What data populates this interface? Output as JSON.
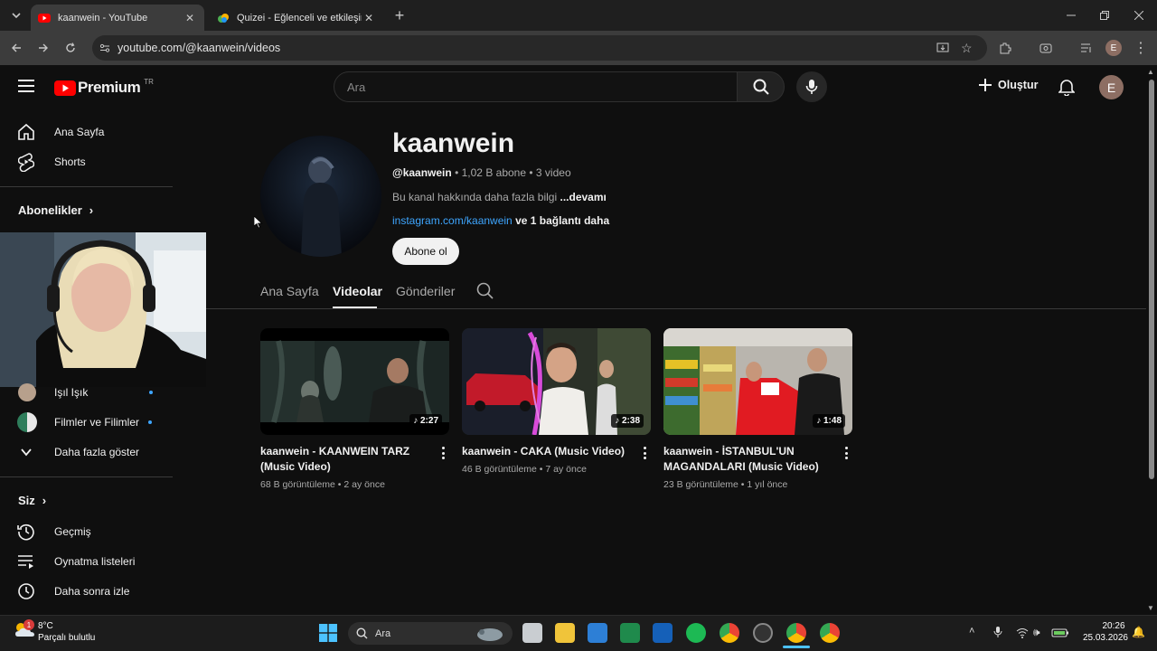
{
  "browser": {
    "tabs": [
      {
        "title": "kaanwein - YouTube",
        "icon": "youtube-favicon"
      },
      {
        "title": "Quizei - Eğlenceli ve etkileşimli",
        "icon": "quizei-favicon"
      }
    ],
    "url": "youtube.com/@kaanwein/videos"
  },
  "youtube": {
    "logo_text": "Premium",
    "logo_region": "TR",
    "search_placeholder": "Ara",
    "create_label": "Oluştur",
    "avatar_letter": "E"
  },
  "sidebar": {
    "top_items": [
      {
        "label": "Ana Sayfa",
        "icon": "home-icon"
      },
      {
        "label": "Shorts",
        "icon": "shorts-icon"
      }
    ],
    "subscriptions_title": "Abonelikler",
    "subscriptions": [
      {
        "label": "Işıl Işık"
      },
      {
        "label": "Filmler ve Filimler"
      }
    ],
    "show_more": "Daha fazla göster",
    "you_title": "Siz",
    "you_items": [
      {
        "label": "Geçmiş",
        "icon": "history-icon"
      },
      {
        "label": "Oynatma listeleri",
        "icon": "playlist-icon"
      },
      {
        "label": "Daha sonra izle",
        "icon": "clock-icon"
      }
    ]
  },
  "channel": {
    "name": "kaanwein",
    "handle": "@kaanwein",
    "subscribers": "1,02 B abone",
    "video_count": "3 video",
    "description": "Bu kanal hakkında daha fazla bilgi",
    "more": "...devamı",
    "link": "instagram.com/kaanwein",
    "link_more": "ve 1 bağlantı daha",
    "subscribe_label": "Abone ol"
  },
  "tabs": [
    "Ana Sayfa",
    "Videolar",
    "Gönderiler"
  ],
  "videos": [
    {
      "title": "kaanwein - KAANWEIN TARZ (Music Video)",
      "duration": "2:27",
      "views": "68 B görüntüleme",
      "age": "2 ay önce"
    },
    {
      "title": "kaanwein - CAKA (Music Video)",
      "duration": "2:38",
      "views": "46 B görüntüleme",
      "age": "7 ay önce"
    },
    {
      "title": "kaanwein - İSTANBUL'UN MAGANDALARI (Music Video)",
      "duration": "1:48",
      "views": "23 B görüntüleme",
      "age": "1 yıl önce"
    }
  ],
  "taskbar": {
    "weather_temp": "8°C",
    "weather_text": "Parçalı bulutlu",
    "weather_badge": "1",
    "search_label": "Ara",
    "time": "20:26",
    "date": "25.03.2026"
  }
}
